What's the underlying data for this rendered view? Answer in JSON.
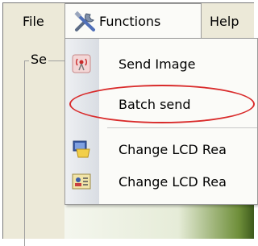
{
  "menubar": {
    "file_label": "File",
    "functions_label": "Functions",
    "help_label": "Help"
  },
  "groupbox": {
    "label": "Se"
  },
  "dropdown": {
    "items": [
      {
        "label": "Send Image",
        "icon": "antenna-icon"
      },
      {
        "label": "Batch send",
        "icon": ""
      },
      {
        "label": "Change LCD Rea",
        "icon": "lcd-folder-icon"
      },
      {
        "label": "Change LCD Rea",
        "icon": "lcd-card-icon"
      }
    ]
  },
  "annotation": {
    "color": "#d92b2b",
    "target": "Batch send"
  }
}
